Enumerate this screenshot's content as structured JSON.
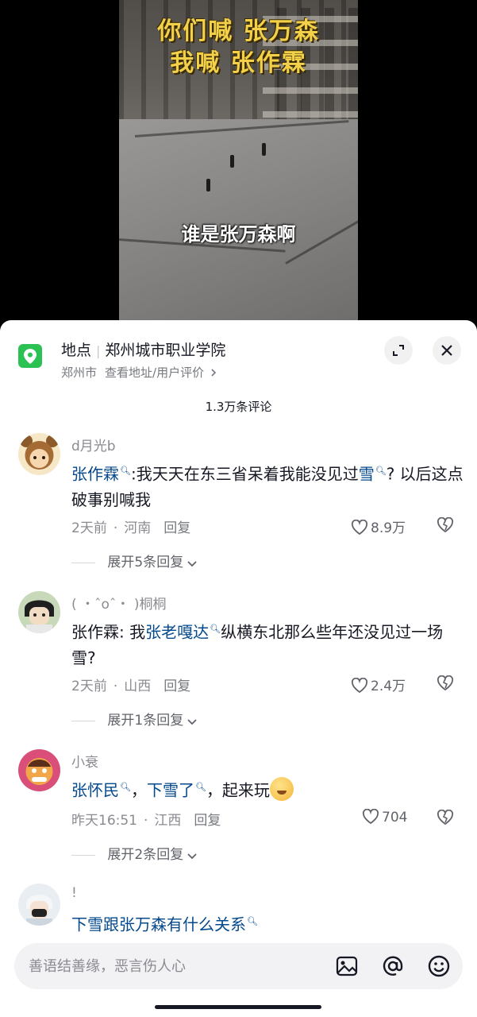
{
  "video": {
    "overlay_line1": "你们喊  张万森",
    "overlay_line2": "我喊  张作霖",
    "subtitle": "谁是张万森啊"
  },
  "location": {
    "label": "地点",
    "name": "郑州城市职业学院",
    "city": "郑州市",
    "link_text": "查看地址/用户评价",
    "icon": "map-pin-icon",
    "accent_color": "#2bc253"
  },
  "comment_count": "1.3万条评论",
  "comments": [
    {
      "username": "d月光b",
      "segments": [
        {
          "text": "张作霖",
          "link": true
        },
        {
          "text": ":我天天在东三省呆着我能没见过",
          "link": false
        },
        {
          "text": "雪",
          "link": true
        },
        {
          "text": "? 以后这点破事别喊我",
          "link": false
        }
      ],
      "time": "2天前",
      "region": "河南",
      "reply_label": "回复",
      "likes": "8.9万",
      "expand_label": "展开5条回复"
    },
    {
      "username": "( ・ˆoˆ・ )桐桐",
      "segments": [
        {
          "text": "张作霖: 我",
          "link": false
        },
        {
          "text": "张老嘎达",
          "link": true
        },
        {
          "text": "纵横东北那么些年还没见过一场雪?",
          "link": false
        }
      ],
      "time": "2天前",
      "region": "山西",
      "reply_label": "回复",
      "likes": "2.4万",
      "expand_label": "展开1条回复"
    },
    {
      "username": "小衰",
      "segments": [
        {
          "text": "张怀民",
          "link": true
        },
        {
          "text": "，",
          "link": false
        },
        {
          "text": "下雪了",
          "link": true
        },
        {
          "text": "，起来玩",
          "link": false
        }
      ],
      "time": "昨天16:51",
      "region": "江西",
      "reply_label": "回复",
      "likes": "704",
      "expand_label": "展开2条回复"
    },
    {
      "username": "!",
      "segments": [
        {
          "text": "下雪跟张万森有什么关系",
          "link": true
        }
      ]
    }
  ],
  "input": {
    "placeholder": "善语结善缘，恶言伤人心",
    "icons": [
      "image-icon",
      "at-icon",
      "emoji-icon"
    ]
  },
  "colors": {
    "link": "#04498d",
    "secondary_text": "#8a8b91",
    "title_yellow": "#f3d04a"
  }
}
